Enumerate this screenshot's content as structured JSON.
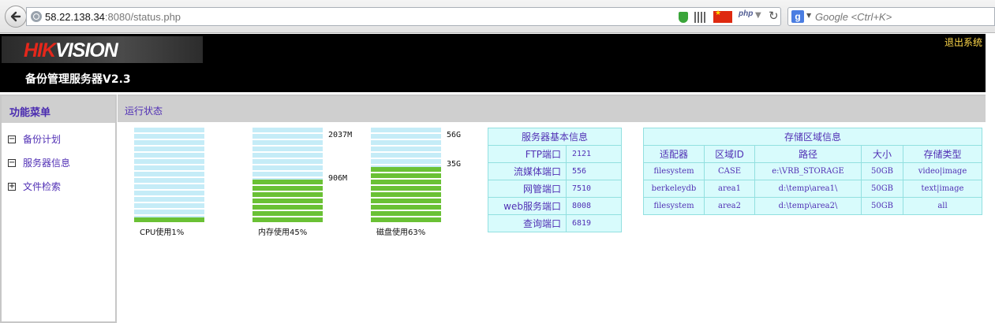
{
  "browser": {
    "url_host": "58.22.138.34",
    "url_rest": ":8080/status.php",
    "search_placeholder": "Google <Ctrl+K>",
    "php_label": "php"
  },
  "header": {
    "logo_red": "HIK",
    "logo_white": "VISION",
    "title": "备份管理服务器V2.3",
    "logout": "退出系统"
  },
  "sidebar": {
    "title": "功能菜单",
    "items": [
      {
        "label": "备份计划",
        "expander": "−"
      },
      {
        "label": "服务器信息",
        "expander": "−"
      },
      {
        "label": "文件检索",
        "expander": "+"
      }
    ]
  },
  "content": {
    "title": "运行状态"
  },
  "usage": {
    "cpu": {
      "label": "CPU使用1%",
      "percent": 1
    },
    "memory": {
      "label": "内存使用45%",
      "percent": 45,
      "total": "2037M",
      "used": "906M"
    },
    "disk": {
      "label": "磁盘使用63%",
      "percent": 63,
      "total": "56G",
      "used": "35G"
    }
  },
  "server_info": {
    "title": "服务器基本信息",
    "rows": [
      {
        "key": "FTP端口",
        "value": "2121"
      },
      {
        "key": "流媒体端口",
        "value": "556"
      },
      {
        "key": "网管端口",
        "value": "7510"
      },
      {
        "key": "web服务端口",
        "value": "8008"
      },
      {
        "key": "查询端口",
        "value": "6819"
      }
    ]
  },
  "storage_info": {
    "title": "存储区域信息",
    "headers": [
      "适配器",
      "区域ID",
      "路径",
      "大小",
      "存储类型"
    ],
    "rows": [
      [
        "filesystem",
        "CASE",
        "e:\\VRB_STORAGE",
        "50GB",
        "video|image"
      ],
      [
        "berkeleydb",
        "area1",
        "d:\\temp\\area1\\",
        "50GB",
        "text|image"
      ],
      [
        "filesystem",
        "area2",
        "d:\\temp\\area2\\",
        "50GB",
        "all"
      ]
    ]
  }
}
